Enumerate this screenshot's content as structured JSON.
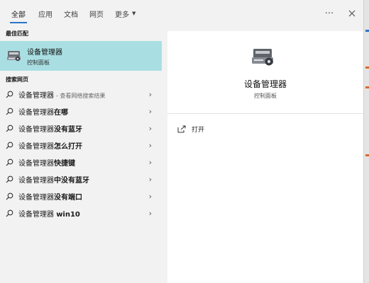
{
  "tabs": [
    {
      "label": "全部",
      "active": true
    },
    {
      "label": "应用"
    },
    {
      "label": "文档"
    },
    {
      "label": "网页"
    },
    {
      "label": "更多"
    }
  ],
  "toolbar": {
    "more_icon": "ellipsis-icon",
    "close_icon": "close-icon"
  },
  "best_match": {
    "section_label": "最佳匹配",
    "title": "设备管理器",
    "subtitle": "控制面板",
    "icon": "device-manager-icon"
  },
  "web_search": {
    "section_label": "搜索网页",
    "results": [
      {
        "query": "设备管理器",
        "bold": "",
        "hint": "- 查看网络搜索结果"
      },
      {
        "query": "设备管理器",
        "bold": "在哪",
        "hint": ""
      },
      {
        "query": "设备管理器",
        "bold": "没有蓝牙",
        "hint": ""
      },
      {
        "query": "设备管理器",
        "bold": "怎么打开",
        "hint": ""
      },
      {
        "query": "设备管理器",
        "bold": "快捷键",
        "hint": ""
      },
      {
        "query": "设备管理器",
        "bold": "中没有蓝牙",
        "hint": ""
      },
      {
        "query": "设备管理器",
        "bold": "没有端口",
        "hint": ""
      },
      {
        "query": "设备管理器 ",
        "bold": "win10",
        "hint": ""
      }
    ]
  },
  "detail": {
    "title": "设备管理器",
    "subtitle": "控制面板",
    "actions": [
      {
        "label": "打开",
        "icon": "open-icon"
      }
    ]
  },
  "colors": {
    "accent": "#2b75c8",
    "selected_bg": "#a9dfe2",
    "panel_bg": "#f2f2f2",
    "detail_bg": "#ffffff"
  }
}
